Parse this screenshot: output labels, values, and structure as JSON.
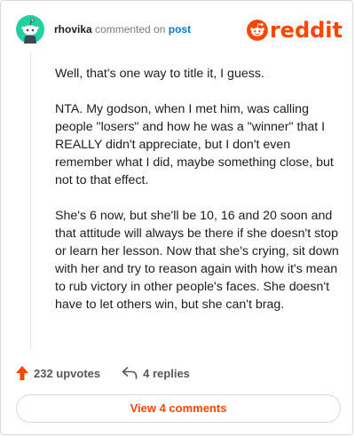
{
  "comment": {
    "username": "rhovika",
    "action_text": "commented on",
    "post_link_text": "post",
    "paragraphs": [
      "Well, that's one way to title it, I guess.",
      "NTA. My godson, when I met him, was calling people \"losers\" and how he was a \"winner\" that I REALLY didn't appreciate, but I don't even remember what I did, maybe something close, but not to that effect.",
      "She's 6 now, but she'll be 10, 16 and 20 soon and that attitude will always be there if she doesn't stop or learn her lesson. Now that she's crying, sit down with her and try to reason again with how it's mean to rub victory in other people's faces. She doesn't have to let others win, but she can't brag."
    ]
  },
  "brand": {
    "logo_text": "reddit",
    "accent_color": "#ff4500",
    "avatar_color": "#24cfa0"
  },
  "footer": {
    "upvotes_label": "232 upvotes",
    "replies_label": "4 replies",
    "upvote_icon": "arrow-up-icon",
    "replies_icon": "reply-arrow-icon"
  },
  "view_button": {
    "label": "View 4 comments"
  }
}
